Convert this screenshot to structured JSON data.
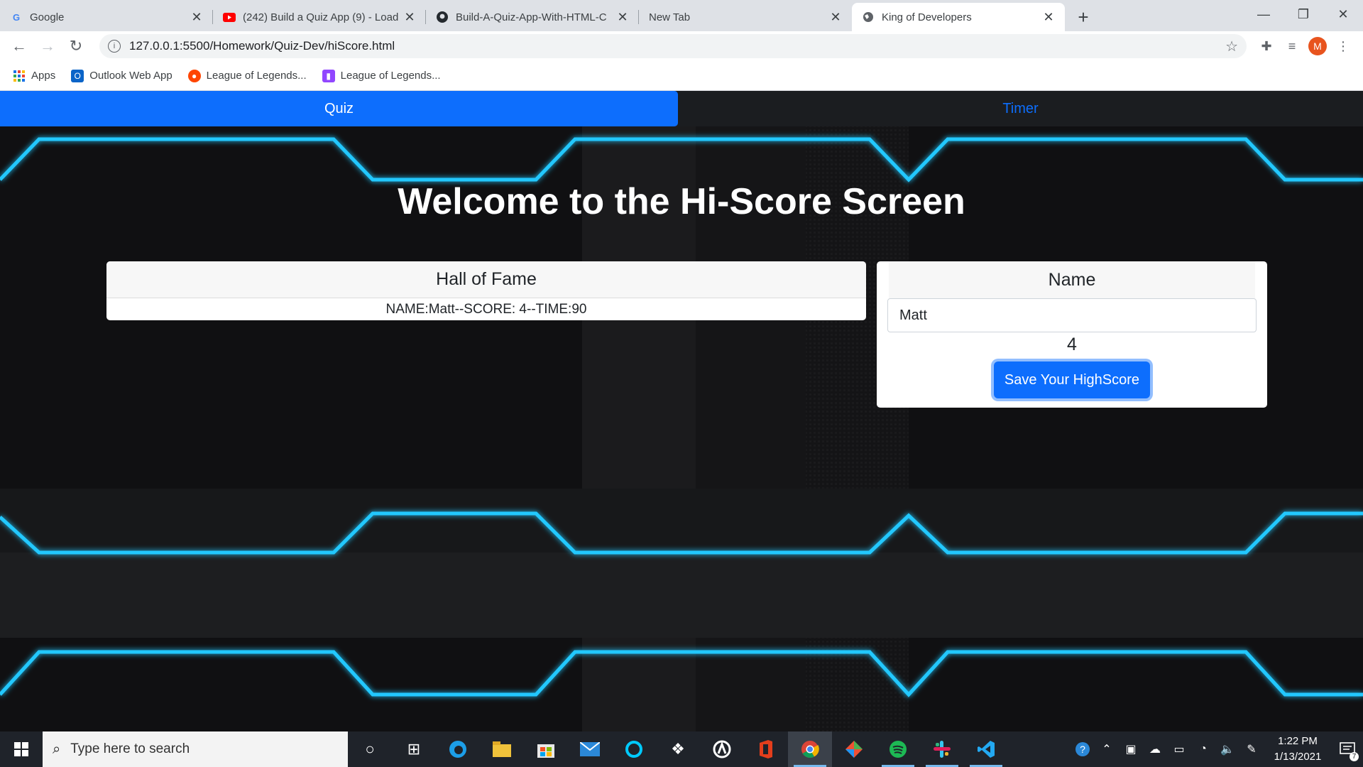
{
  "browser": {
    "tabs": [
      {
        "title": "Google",
        "icon": "google-icon"
      },
      {
        "title": "(242) Build a Quiz App (9) - Load",
        "icon": "youtube-icon"
      },
      {
        "title": "Build-A-Quiz-App-With-HTML-C",
        "icon": "github-icon"
      },
      {
        "title": "New Tab",
        "icon": ""
      },
      {
        "title": "King of Developers",
        "icon": "globe-icon"
      }
    ],
    "url": "127.0.0.1:5500/Homework/Quiz-Dev/hiScore.html",
    "profile_initial": "M",
    "bookmarks": [
      {
        "label": "Apps",
        "icon": "apps-grid-icon"
      },
      {
        "label": "Outlook Web App",
        "icon": "outlook-icon"
      },
      {
        "label": "League of Legends...",
        "icon": "reddit-icon"
      },
      {
        "label": "League of Legends...",
        "icon": "twitch-icon"
      }
    ]
  },
  "page": {
    "nav": {
      "quiz": "Quiz",
      "timer": "Timer"
    },
    "heading": "Welcome to the Hi-Score Screen",
    "hall_of_fame": {
      "title": "Hall of Fame",
      "entries": [
        "NAME:Matt--SCORE: 4--TIME:90"
      ]
    },
    "name_card": {
      "title": "Name",
      "input_value": "Matt",
      "score": "4",
      "save_label": "Save Your HighScore"
    },
    "colors": {
      "primary": "#0d6efd",
      "neon": "#21c8ff"
    }
  },
  "taskbar": {
    "search_placeholder": "Type here to search",
    "time": "1:22 PM",
    "date": "1/13/2021",
    "notification_count": "7"
  }
}
